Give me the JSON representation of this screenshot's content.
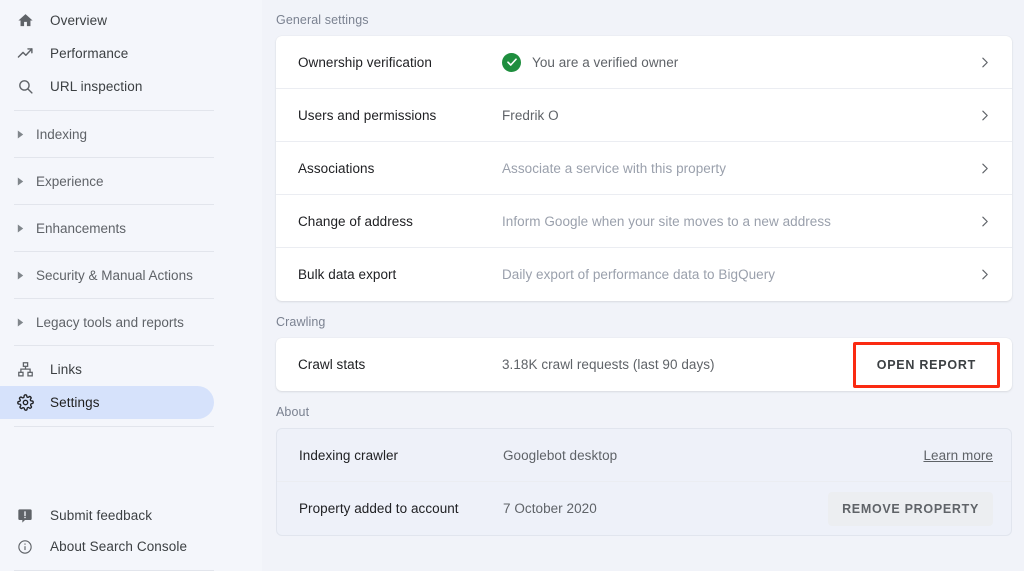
{
  "sidebar": {
    "primary_items": [
      {
        "label": "Overview",
        "icon": "home-icon",
        "id": "overview"
      },
      {
        "label": "Performance",
        "icon": "trending-up-icon",
        "id": "performance"
      },
      {
        "label": "URL inspection",
        "icon": "search-icon",
        "id": "url-inspection"
      }
    ],
    "collapsible_sections": [
      {
        "label": "Indexing",
        "id": "indexing"
      },
      {
        "label": "Experience",
        "id": "experience"
      },
      {
        "label": "Enhancements",
        "id": "enhancements"
      },
      {
        "label": "Security & Manual Actions",
        "id": "security-manual-actions"
      },
      {
        "label": "Legacy tools and reports",
        "id": "legacy-tools-and-reports"
      }
    ],
    "tool_items": [
      {
        "label": "Links",
        "icon": "sitemap-icon",
        "id": "links",
        "active": false
      },
      {
        "label": "Settings",
        "icon": "gear-icon",
        "id": "settings",
        "active": true
      }
    ],
    "footer_items": [
      {
        "label": "Submit feedback",
        "icon": "feedback-icon",
        "id": "submit-feedback"
      },
      {
        "label": "About Search Console",
        "icon": "info-icon",
        "id": "about-search-console"
      }
    ],
    "active_color": "#d6e2fb"
  },
  "main": {
    "general": {
      "section_label": "General settings",
      "rows": [
        {
          "title": "Ownership verification",
          "value": "You are a verified owner",
          "status_icon": "verified-check-icon",
          "status_color": "#1e8e3e",
          "value_tone": "dark",
          "action": "chevron-right-icon"
        },
        {
          "title": "Users and permissions",
          "value": "Fredrik O",
          "value_tone": "dark",
          "action": "chevron-right-icon"
        },
        {
          "title": "Associations",
          "value": "Associate a service with this property",
          "value_tone": "muted",
          "action": "chevron-right-icon"
        },
        {
          "title": "Change of address",
          "value": "Inform Google when your site moves to a new address",
          "value_tone": "muted",
          "action": "chevron-right-icon"
        },
        {
          "title": "Bulk data export",
          "value": "Daily export of performance data to BigQuery",
          "value_tone": "muted",
          "action": "chevron-right-icon"
        }
      ]
    },
    "crawling": {
      "section_label": "Crawling",
      "row": {
        "title": "Crawl stats",
        "value": "3.18K crawl requests (last 90 days)",
        "button_label": "OPEN REPORT",
        "highlight_color": "#fa2a12"
      }
    },
    "about": {
      "section_label": "About",
      "rows": [
        {
          "title": "Indexing crawler",
          "value": "Googlebot desktop",
          "link_label": "Learn more"
        },
        {
          "title": "Property added to account",
          "value": "7 October 2020",
          "button_label": "REMOVE PROPERTY"
        }
      ]
    }
  }
}
